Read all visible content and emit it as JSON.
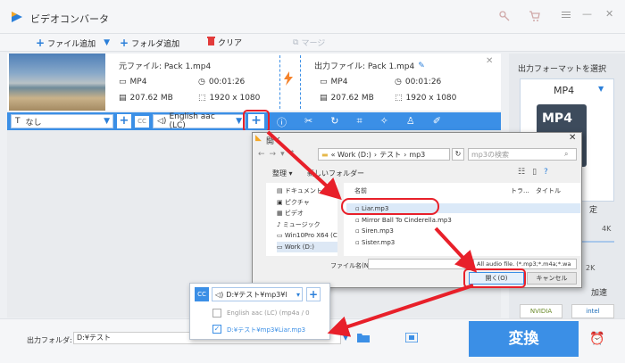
{
  "title": "ビデオコンバータ",
  "toolbar": {
    "add_file": "ファイル追加",
    "add_folder": "フォルダ追加",
    "clear": "クリア",
    "merge": "マージ"
  },
  "file": {
    "source_label": "元ファイル: Pack 1.mp4",
    "output_label": "出力ファイル: Pack 1.mp4",
    "src_format": "MP4",
    "src_duration": "00:01:26",
    "src_size": "207.62 MB",
    "src_res": "1920 x 1080",
    "out_format": "MP4",
    "out_duration": "00:01:26",
    "out_size": "207.62 MB",
    "out_res": "1920 x 1080"
  },
  "edit_bar": {
    "subtitle": "なし",
    "audio": "English aac (LC)",
    "cc": "CC"
  },
  "right_panel": {
    "header": "出力フォーマットを選択",
    "format": "MP4",
    "thumb_text": "MP4",
    "partial_setting": "定",
    "partial_4k": "4K",
    "partial_2k": "2K",
    "partial_hw": "加速",
    "nvidia": "NVIDIA",
    "intel": "intel"
  },
  "dialog": {
    "title": "開く",
    "path_root": "« Work (D:)",
    "path_test": "テスト",
    "path_mp3": "mp3",
    "search_placeholder": "mp3の検索",
    "organize": "整理 ▾",
    "new_folder": "新しいフォルダー",
    "nav": [
      "ドキュメント",
      "ピクチャ",
      "ビデオ",
      "ミュージック",
      "Win10Pro X64 (C",
      "Work (D:)"
    ],
    "col_name": "名前",
    "col_track": "トラ...",
    "col_title": "タイトル",
    "files": [
      "Liar.mp3",
      "Mirror Ball To Cinderella.mp3",
      "Siren.mp3",
      "Sister.mp3"
    ],
    "filename_label": "ファイル名(N):",
    "filter": "All audio file. (*.mp3;*.m4a;*.wa",
    "open": "開く(O)",
    "cancel": "キャンセル"
  },
  "popup": {
    "selected": "D:¥テスト¥mp3¥l",
    "opt1": "English aac (LC) (mp4a / 0",
    "opt2": "D:¥テスト¥mp3¥Liar.mp3"
  },
  "bottom": {
    "output_folder_label": "出力フォルダ:",
    "output_folder_value": "D:¥テスト",
    "convert": "変換"
  }
}
